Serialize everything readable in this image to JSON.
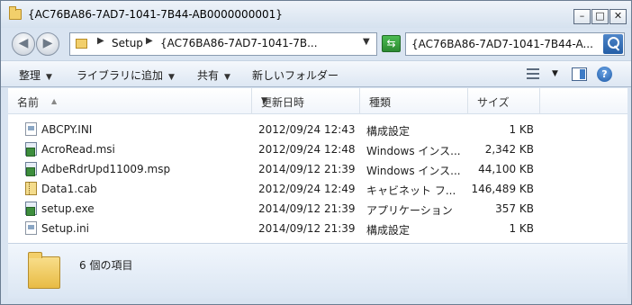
{
  "window": {
    "title": "{AC76BA86-7AD7-1041-7B44-AB0000000001}",
    "min_label": "–",
    "max_label": "□",
    "close_label": "✕"
  },
  "address": {
    "segments": [
      "Setup",
      "{AC76BA86-7AD7-1041-7B..."
    ],
    "search_text": "{AC76BA86-7AD7-1041-7B44-A..."
  },
  "toolbar": {
    "organize_label": "整理",
    "library_label": "ライブラリに追加",
    "share_label": "共有",
    "new_folder_label": "新しいフォルダー"
  },
  "columns": {
    "name": "名前",
    "date": "更新日時",
    "type": "種類",
    "size": "サイズ"
  },
  "files": [
    {
      "name": "ABCPY.INI",
      "date": "2012/09/24 12:43",
      "type": "構成設定",
      "size": "1 KB",
      "icon": "ini-file-icon"
    },
    {
      "name": "AcroRead.msi",
      "date": "2012/09/24 12:48",
      "type": "Windows インス...",
      "size": "2,342 KB",
      "icon": "msi-file-icon"
    },
    {
      "name": "AdbeRdrUpd11009.msp",
      "date": "2014/09/12 21:39",
      "type": "Windows インス...",
      "size": "44,100 KB",
      "icon": "msp-file-icon"
    },
    {
      "name": "Data1.cab",
      "date": "2012/09/24 12:49",
      "type": "キャビネット フ...",
      "size": "146,489 KB",
      "icon": "cab-file-icon"
    },
    {
      "name": "setup.exe",
      "date": "2014/09/12 21:39",
      "type": "アプリケーション",
      "size": "357 KB",
      "icon": "exe-file-icon"
    },
    {
      "name": "Setup.ini",
      "date": "2014/09/12 21:39",
      "type": "構成設定",
      "size": "1 KB",
      "icon": "ini-file-icon"
    }
  ],
  "details": {
    "item_count": "6 個の項目"
  },
  "colors": {
    "window_frame": "#d9e4f1",
    "accent": "#245ea6"
  }
}
